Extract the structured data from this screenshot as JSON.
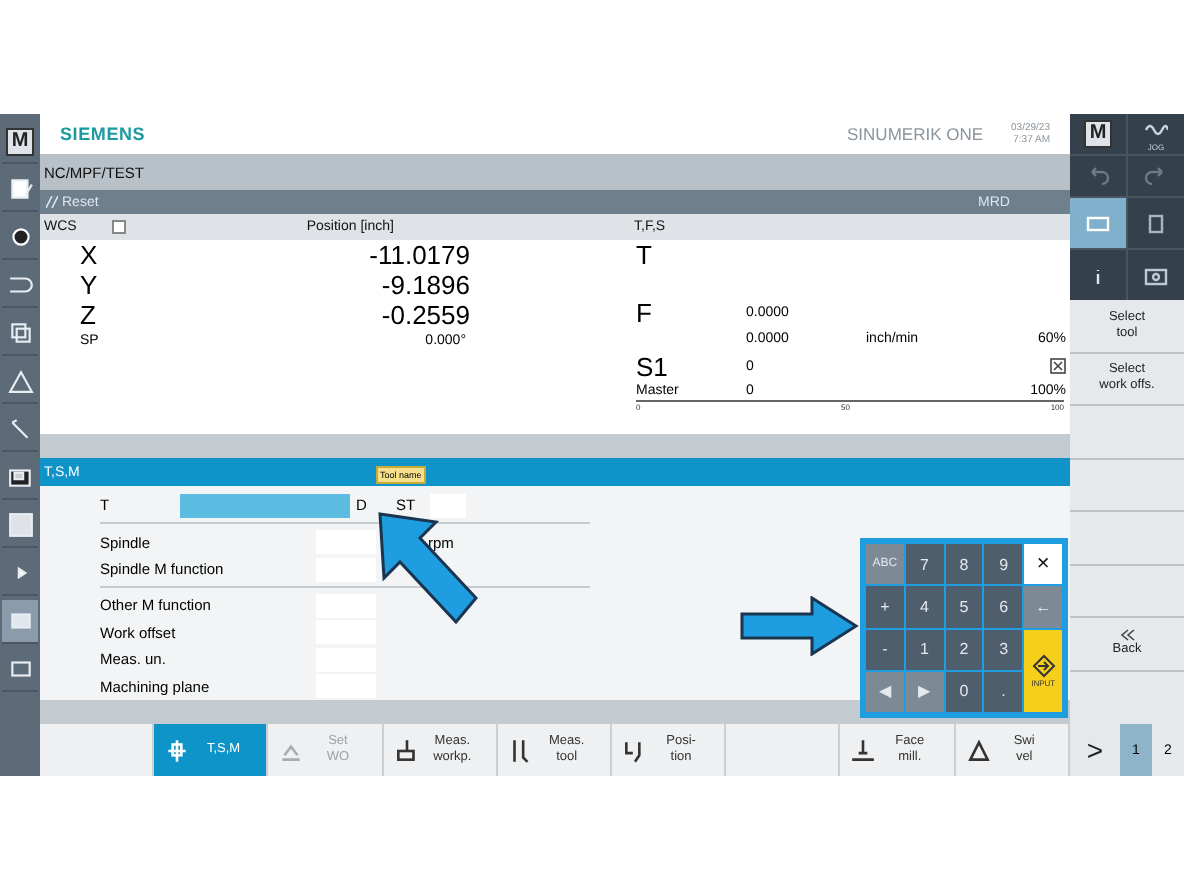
{
  "header": {
    "brand": "SIEMENS",
    "product": "SINUMERIK ONE",
    "date": "03/29/23",
    "time": "7:37 AM"
  },
  "left_bar": {
    "mode_key": "M"
  },
  "program_path": "NC/MPF/TEST",
  "status": {
    "reset": "Reset",
    "channel_state": "MRD"
  },
  "position": {
    "title": "WCS",
    "checked": false,
    "column": "Position [inch]",
    "axes": [
      {
        "name": "X",
        "value": "-11.0179",
        "kind": "large"
      },
      {
        "name": "Y",
        "value": "-9.1896",
        "kind": "large"
      },
      {
        "name": "Z",
        "value": "-0.2559",
        "kind": "large"
      },
      {
        "name": "SP",
        "value": "0.000°",
        "kind": "small"
      }
    ]
  },
  "tfs": {
    "title": "T,F,S",
    "tool": "T",
    "feed": {
      "letter": "F",
      "value": "0.0000",
      "actual": "0.0000",
      "unit": "inch/min",
      "override": "60%"
    },
    "spindle": {
      "name": "S1",
      "value": "0",
      "master": "Master",
      "master_value": "0",
      "override": "100%",
      "scale": [
        "0",
        "50",
        "100"
      ]
    }
  },
  "tsm": {
    "title": "T,S,M",
    "tooltip": "Tool name",
    "tool": {
      "label": "T",
      "d": "D",
      "st": "ST"
    },
    "groups": [
      [
        {
          "label": "Spindle",
          "unit": "rpm"
        },
        {
          "label": "Spindle M function"
        }
      ],
      [
        {
          "label": "Other M function"
        },
        {
          "label": "Work offset"
        },
        {
          "label": "Meas. un."
        },
        {
          "label": "Machining plane"
        }
      ]
    ]
  },
  "right_keys": [
    {
      "kind": "text",
      "label": "M",
      "selected": false
    },
    {
      "kind": "text",
      "label": "JOG",
      "selected": false
    },
    {
      "kind": "undo",
      "selected": false
    },
    {
      "kind": "redo",
      "selected": false
    },
    {
      "kind": "keyboard",
      "selected": true
    },
    {
      "kind": "calculator",
      "selected": false
    },
    {
      "kind": "info",
      "selected": false
    },
    {
      "kind": "camera",
      "selected": false
    }
  ],
  "vertical_softkeys": [
    {
      "kind": "text",
      "label": "Select\ntool"
    },
    {
      "kind": "text",
      "label": "Select\nwork offs."
    },
    {
      "kind": "blank"
    },
    {
      "kind": "blank"
    },
    {
      "kind": "blank"
    },
    {
      "kind": "blank"
    },
    {
      "kind": "back",
      "label": "Back"
    }
  ],
  "softkeys": [
    {
      "kind": "blank"
    },
    {
      "kind": "tsm",
      "label": "T,S,M",
      "selected": true,
      "disabled": false
    },
    {
      "kind": "setwo",
      "label": "Set\nWO",
      "selected": false,
      "disabled": true
    },
    {
      "kind": "workp",
      "label": "Meas.\nworkp.",
      "selected": false,
      "disabled": false
    },
    {
      "kind": "tool",
      "label": "Meas.\ntool",
      "selected": false,
      "disabled": false
    },
    {
      "kind": "position",
      "label": "Posi-\ntion",
      "selected": false,
      "disabled": false
    },
    {
      "kind": "blank"
    },
    {
      "kind": "face",
      "label": "Face\nmill.",
      "selected": false,
      "disabled": false
    },
    {
      "kind": "swivel",
      "label": "Swi\nvel",
      "selected": false,
      "disabled": false
    }
  ],
  "page_nav": {
    "next": ">",
    "pages": [
      {
        "label": "1",
        "selected": true
      },
      {
        "label": "2",
        "selected": false
      }
    ]
  },
  "keypad": {
    "keys": [
      {
        "kind": "abc",
        "label": "ABC"
      },
      {
        "kind": "num",
        "label": "7"
      },
      {
        "kind": "num",
        "label": "8"
      },
      {
        "kind": "num",
        "label": "9"
      },
      {
        "kind": "close",
        "label": "×"
      },
      {
        "kind": "num",
        "label": "+"
      },
      {
        "kind": "num",
        "label": "4"
      },
      {
        "kind": "num",
        "label": "5"
      },
      {
        "kind": "num",
        "label": "6"
      },
      {
        "kind": "back",
        "label": "←"
      },
      {
        "kind": "num",
        "label": "-"
      },
      {
        "kind": "num",
        "label": "1"
      },
      {
        "kind": "num",
        "label": "2"
      },
      {
        "kind": "num",
        "label": "3"
      },
      {
        "kind": "input",
        "label": "INPUT"
      },
      {
        "kind": "nav",
        "label": "◀"
      },
      {
        "kind": "nav",
        "label": "▶"
      },
      {
        "kind": "num",
        "label": "0"
      },
      {
        "kind": "num",
        "label": "."
      }
    ]
  }
}
